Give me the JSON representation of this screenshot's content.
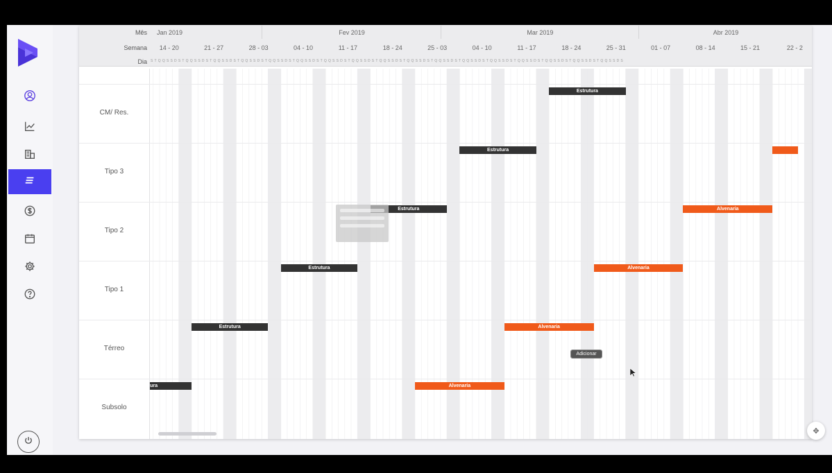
{
  "sidebar": {
    "brand_color": "#5b3ff0",
    "active_color": "#4a3ff0",
    "items": [
      {
        "icon": "user-circle-icon"
      },
      {
        "icon": "line-chart-icon"
      },
      {
        "icon": "buildings-icon"
      },
      {
        "icon": "list-icon",
        "active": true
      },
      {
        "icon": "dollar-icon"
      },
      {
        "icon": "calendar-icon"
      },
      {
        "icon": "gear-icon"
      },
      {
        "icon": "help-icon"
      }
    ],
    "power_icon": "power-icon"
  },
  "timeline": {
    "header_labels": {
      "mes": "Mês",
      "semana": "Semana",
      "dia": "Dia"
    },
    "months": [
      "Jan 2019",
      "Fev 2019",
      "Mar 2019",
      "Abr 2019"
    ],
    "weeks": [
      "14 - 20",
      "21 - 27",
      "28 - 03",
      "04 - 10",
      "11 - 17",
      "18 - 24",
      "25 - 03",
      "04 - 10",
      "11 - 17",
      "18 - 24",
      "25 - 31",
      "01 - 07",
      "08 - 14",
      "15 - 21",
      "22 - 2"
    ],
    "day_pattern": "S T Q Q S S D"
  },
  "rows": [
    {
      "label": "CM/ Res."
    },
    {
      "label": "Tipo 3"
    },
    {
      "label": "Tipo 2"
    },
    {
      "label": "Tipo 1"
    },
    {
      "label": "Térreo"
    },
    {
      "label": "Subsolo"
    }
  ],
  "tasks": [
    {
      "row": "CM/ Res.",
      "label": "Estrutura",
      "color": "#333333",
      "start": "2019-03-18",
      "end": "2019-03-29"
    },
    {
      "row": "Tipo 3",
      "label": "Estrutura",
      "color": "#333333",
      "start": "2019-03-04",
      "end": "2019-03-15"
    },
    {
      "row": "Tipo 3",
      "label": "",
      "color": "#f05a1a",
      "start": "2019-04-22",
      "end": "2019-04-25"
    },
    {
      "row": "Tipo 2",
      "label": "Estrutura",
      "color": "#333333",
      "start": "2019-02-18",
      "end": "2019-03-01"
    },
    {
      "row": "Tipo 2",
      "label": "Alvenaria",
      "color": "#f05a1a",
      "start": "2019-04-08",
      "end": "2019-04-21"
    },
    {
      "row": "Tipo 1",
      "label": "Estrutura",
      "color": "#333333",
      "start": "2019-02-04",
      "end": "2019-02-15"
    },
    {
      "row": "Tipo 1",
      "label": "Alvenaria",
      "color": "#f05a1a",
      "start": "2019-03-25",
      "end": "2019-04-07"
    },
    {
      "row": "Térreo",
      "label": "Estrutura",
      "color": "#333333",
      "start": "2019-01-21",
      "end": "2019-02-01"
    },
    {
      "row": "Térreo",
      "label": "Alvenaria",
      "color": "#f05a1a",
      "start": "2019-03-11",
      "end": "2019-03-24"
    },
    {
      "row": "Subsolo",
      "label": "Estrutura",
      "color": "#333333",
      "start": "2019-01-07",
      "end": "2019-01-20"
    },
    {
      "row": "Subsolo",
      "label": "Alvenaria",
      "color": "#f05a1a",
      "start": "2019-02-25",
      "end": "2019-03-10"
    }
  ],
  "add_button": {
    "label": "Adicionar",
    "row": "Térreo"
  },
  "float_button_icon": "move-icon"
}
